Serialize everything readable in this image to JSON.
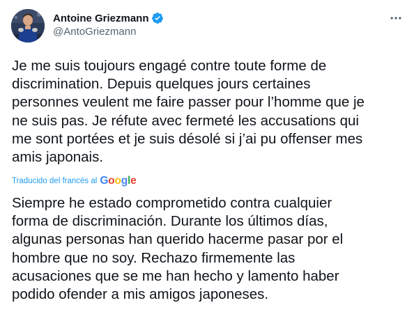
{
  "author": {
    "display_name": "Antoine Griezmann",
    "handle": "@AntoGriezmann",
    "verified": true,
    "avatar_icon": "profile-photo"
  },
  "tweet": {
    "text": "Je me suis toujours engagé contre toute forme de\ndiscrimination. Depuis quelques jours certaines\npersonnes veulent me faire passer pour l’homme que je\nne suis pas. Je réfute avec fermeté les accusations qui\nme sont portées et je suis désolé si j’ai pu offenser mes\namis japonais."
  },
  "translation": {
    "label": "Traducido del francés al",
    "provider_letters": [
      "G",
      "o",
      "o",
      "g",
      "l",
      "e"
    ],
    "text": "Siempre he estado comprometido contra cualquier\nforma de discriminación. Durante los últimos días,\nalgunas personas han querido hacerme pasar por el\nhombre que no soy. Rechazo firmemente las\nacusaciones que se me han hecho y lamento haber\npodido ofender a mis amigos japoneses."
  },
  "colors": {
    "accent": "#1d9bf0",
    "text_primary": "#0f1419",
    "text_secondary": "#536471"
  },
  "icons": {
    "verified": "verified-badge-icon",
    "more": "more-options-icon"
  }
}
